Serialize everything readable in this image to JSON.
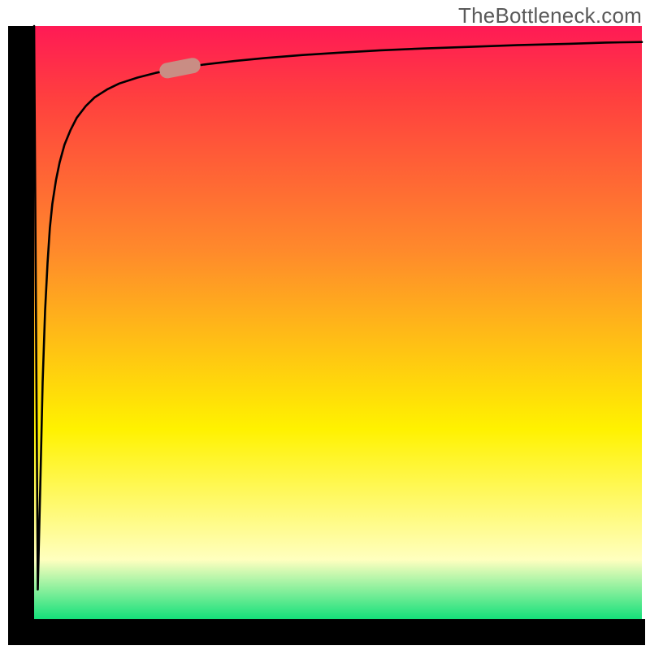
{
  "attribution": "TheBottleneck.com",
  "colors": {
    "axis": "#000000",
    "curve": "#000000",
    "marker_fill": "#c98d84",
    "marker_stroke": "#c98d84",
    "gradient_top": "#ff1a55",
    "gradient_red": "#ff3f3f",
    "gradient_orange": "#ff8a2b",
    "gradient_yellow": "#fff200",
    "gradient_yellow_light": "#ffffbf",
    "gradient_green": "#14e07a"
  },
  "chart_data": {
    "type": "line",
    "title": "",
    "xlabel": "",
    "ylabel": "",
    "xlim": [
      0,
      100
    ],
    "ylim": [
      0,
      100
    ],
    "x": [
      0,
      0.6,
      1.0,
      1.4,
      1.8,
      2.2,
      2.6,
      3.0,
      3.6,
      4.2,
      5.0,
      6.0,
      7.0,
      8.5,
      10,
      12,
      14,
      17,
      20,
      24,
      28,
      33,
      38,
      44,
      50,
      57,
      64,
      72,
      80,
      88,
      94,
      100
    ],
    "y": [
      100,
      5,
      22,
      40,
      52,
      60,
      66,
      70,
      74,
      77,
      80,
      82.5,
      84.5,
      86.5,
      88,
      89.3,
      90.3,
      91.3,
      92.1,
      92.9,
      93.5,
      94.1,
      94.6,
      95.1,
      95.5,
      95.9,
      96.2,
      96.5,
      96.8,
      97.0,
      97.2,
      97.3
    ],
    "marker": {
      "x": 24,
      "y": 92.9
    },
    "grid": false,
    "legend": false
  }
}
